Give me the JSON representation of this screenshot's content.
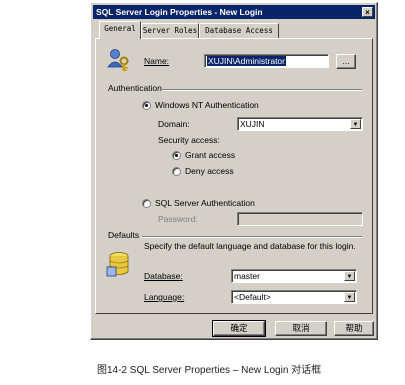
{
  "window": {
    "title": "SQL Server Login Properties - New Login",
    "close_glyph": "×"
  },
  "tabs": [
    {
      "label": "General",
      "active": true
    },
    {
      "label": "Server Roles",
      "active": false
    },
    {
      "label": "Database Access",
      "active": false
    }
  ],
  "general": {
    "name_label": "Name:",
    "name_value": "XUJIN\\Administrator",
    "browse_label": "...",
    "authentication_group": "Authentication",
    "windows_auth_label": "Windows NT Authentication",
    "domain_label": "Domain:",
    "domain_value": "XUJIN",
    "security_access_label": "Security access:",
    "grant_access_label": "Grant access",
    "deny_access_label": "Deny access",
    "sql_auth_label": "SQL Server Authentication",
    "password_label": "Password:",
    "password_value": "",
    "defaults_group": "Defaults",
    "defaults_description": "Specify the default language and database for this login.",
    "database_label": "Database:",
    "database_value": "master",
    "language_label": "Language:",
    "language_value": "<Default>"
  },
  "buttons": {
    "ok": "确定",
    "cancel": "取消",
    "help": "帮助"
  },
  "caption": "图14-2  SQL Server Properties – New Login 对话框",
  "colors": {
    "dialog_bg": "#d4d0c8",
    "titlebar": "#0a246a",
    "selection": "#0a246a"
  },
  "icons": [
    "key-user-icon",
    "database-icon",
    "dropdown-arrow-icon"
  ]
}
